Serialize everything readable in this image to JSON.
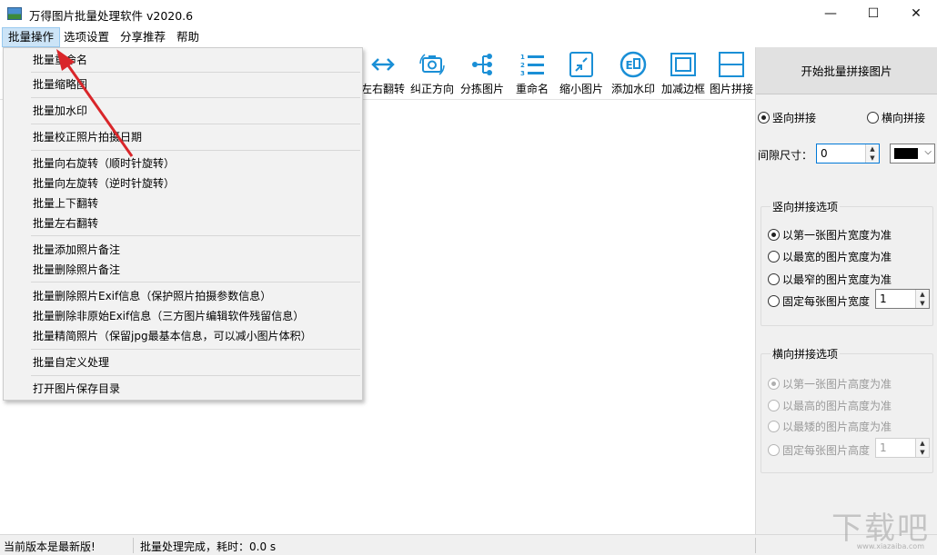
{
  "window": {
    "title": "万得图片批量处理软件 v2020.6",
    "minimize_glyph": "—",
    "maximize_glyph": "☐",
    "close_glyph": "✕"
  },
  "menubar": {
    "items": [
      "批量操作",
      "选项设置",
      "分享推荐",
      "帮助"
    ]
  },
  "toolbar": {
    "items": [
      {
        "label": "左右翻转",
        "icon": "flip-horizontal-icon"
      },
      {
        "label": "纠正方向",
        "icon": "camera-rotate-icon"
      },
      {
        "label": "分拣图片",
        "icon": "sort-tree-icon"
      },
      {
        "label": "重命名",
        "icon": "numbered-list-icon"
      },
      {
        "label": "缩小图片",
        "icon": "shrink-icon"
      },
      {
        "label": "添加水印",
        "icon": "watermark-stamp-icon"
      },
      {
        "label": "加减边框",
        "icon": "border-frame-icon"
      },
      {
        "label": "图片拼接",
        "icon": "split-layout-icon"
      }
    ]
  },
  "dropdown": {
    "items": [
      "批量重命名",
      "批量缩略图",
      "批量加水印",
      "批量校正照片拍摄日期",
      "批量向右旋转（顺时针旋转）",
      "批量向左旋转（逆时针旋转）",
      "批量上下翻转",
      "批量左右翻转",
      "批量添加照片备注",
      "批量删除照片备注",
      "批量删除照片Exif信息（保护照片拍摄参数信息）",
      "批量删除非原始Exif信息（三方图片编辑软件残留信息）",
      "批量精简照片（保留jpg最基本信息，可以减小图片体积）",
      "批量自定义处理",
      "打开图片保存目录"
    ]
  },
  "rightpanel": {
    "start_button": "开始批量拼接图片",
    "vertical_label": "竖向拼接",
    "horizontal_label": "横向拼接",
    "mode_selected": "竖向拼接",
    "gap_label": "间隙尺寸：",
    "gap_value": "0",
    "gap_color": "#000000",
    "vertical_group": {
      "title": "竖向拼接选项",
      "options": [
        "以第一张图片宽度为准",
        "以最宽的图片宽度为准",
        "以最窄的图片宽度为准",
        "固定每张图片宽度"
      ],
      "selected": 0,
      "fixed_value": "1"
    },
    "horizontal_group": {
      "title": "横向拼接选项",
      "options": [
        "以第一张图片高度为准",
        "以最高的图片高度为准",
        "以最矮的图片高度为准",
        "固定每张图片高度"
      ],
      "selected": 0,
      "fixed_value": "1"
    }
  },
  "statusbar": {
    "version_text": "当前版本是最新版!",
    "process_text": "批量处理完成，耗时：0.0 s"
  },
  "watermark": {
    "text": "下载吧",
    "sub": "www.xiazaiba.com"
  },
  "colors": {
    "menu_highlight": "#cce4f7",
    "toolbar_icon": "#1a8fd6",
    "arrow": "#d9262a"
  }
}
